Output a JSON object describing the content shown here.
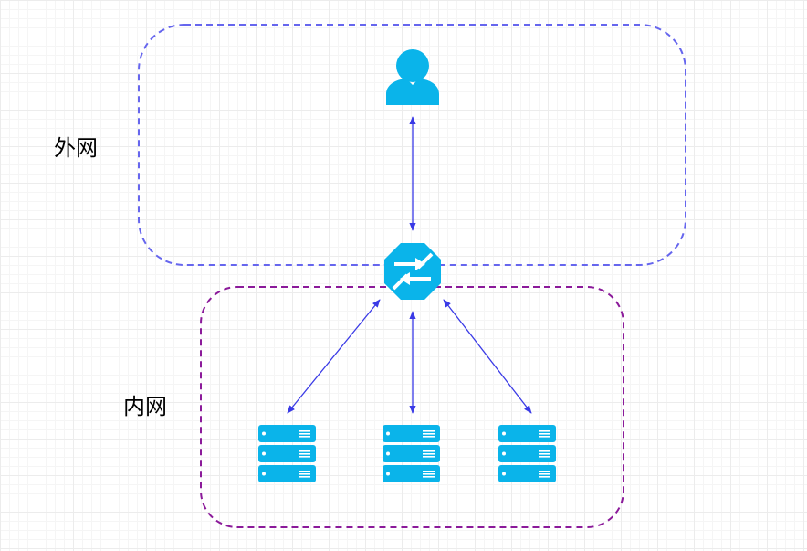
{
  "zones": {
    "external": {
      "label": "外网",
      "border_color": "#6666ee"
    },
    "internal": {
      "label": "内网",
      "border_color": "#8b1a9a"
    }
  },
  "nodes": {
    "user": {
      "icon": "user-icon",
      "color": "#0ab4ea"
    },
    "router": {
      "icon": "router-icon",
      "color": "#0ab4ea"
    },
    "servers": [
      {
        "icon": "server-icon",
        "color": "#0ab4ea"
      },
      {
        "icon": "server-icon",
        "color": "#0ab4ea"
      },
      {
        "icon": "server-icon",
        "color": "#0ab4ea"
      }
    ]
  },
  "edges": [
    {
      "from": "user",
      "to": "router",
      "style": "bidirectional"
    },
    {
      "from": "router",
      "to": "server-1",
      "style": "bidirectional"
    },
    {
      "from": "router",
      "to": "server-2",
      "style": "bidirectional"
    },
    {
      "from": "router",
      "to": "server-3",
      "style": "bidirectional"
    }
  ],
  "edge_color": "#3a3ae6"
}
